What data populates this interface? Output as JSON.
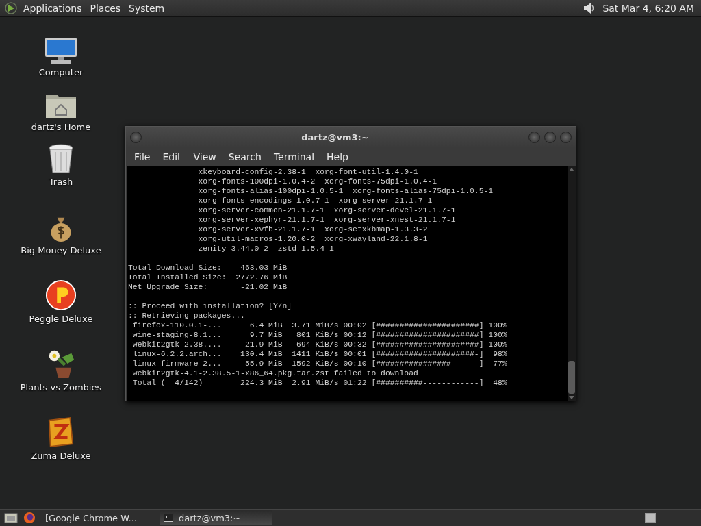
{
  "top_panel": {
    "menus": [
      "Applications",
      "Places",
      "System"
    ],
    "clock": "Sat Mar  4,  6:20 AM"
  },
  "desktop_icons": [
    {
      "kind": "computer",
      "label": "Computer"
    },
    {
      "kind": "home",
      "label": "dartz's Home"
    },
    {
      "kind": "trash",
      "label": "Trash"
    },
    {
      "kind": "money",
      "label": "Big Money Deluxe"
    },
    {
      "kind": "peggle",
      "label": "Peggle Deluxe"
    },
    {
      "kind": "plants",
      "label": "Plants vs Zombies"
    },
    {
      "kind": "zuma",
      "label": "Zuma Deluxe"
    }
  ],
  "window": {
    "title": "dartz@vm3:~",
    "menu": [
      "File",
      "Edit",
      "View",
      "Search",
      "Terminal",
      "Help"
    ],
    "output_blocks": [
      {
        "lines": [
          "               xkeyboard-config-2.38-1  xorg-font-util-1.4.0-1",
          "               xorg-fonts-100dpi-1.0.4-2  xorg-fonts-75dpi-1.0.4-1",
          "               xorg-fonts-alias-100dpi-1.0.5-1  xorg-fonts-alias-75dpi-1.0.5-1",
          "               xorg-fonts-encodings-1.0.7-1  xorg-server-21.1.7-1",
          "               xorg-server-common-21.1.7-1  xorg-server-devel-21.1.7-1",
          "               xorg-server-xephyr-21.1.7-1  xorg-server-xnest-21.1.7-1",
          "               xorg-server-xvfb-21.1.7-1  xorg-setxkbmap-1.3.3-2",
          "               xorg-util-macros-1.20.0-2  xorg-xwayland-22.1.8-1",
          "               zenity-3.44.0-2  zstd-1.5.4-1"
        ]
      },
      {
        "lines": [
          "Total Download Size:    463.03 MiB",
          "Total Installed Size:  2772.76 MiB",
          "Net Upgrade Size:       -21.02 MiB"
        ]
      },
      {
        "lines": [
          ":: Proceed with installation? [Y/n]",
          ":: Retrieving packages...",
          " firefox-110.0.1-...      6.4 MiB  3.71 MiB/s 00:02 [######################] 100%",
          " wine-staging-8.1...      9.7 MiB   801 KiB/s 00:12 [######################] 100%",
          " webkit2gtk-2.38....     21.9 MiB   694 KiB/s 00:32 [######################] 100%",
          " linux-6.2.2.arch...    130.4 MiB  1411 KiB/s 00:01 [#####################-]  98%",
          " linux-firmware-2...     55.9 MiB  1592 KiB/s 00:10 [################------]  77%",
          " webkit2gtk-4.1-2.38.5-1-x86_64.pkg.tar.zst failed to download",
          " Total (  4/142)        224.3 MiB  2.91 MiB/s 01:22 [##########------------]  48%"
        ]
      }
    ]
  },
  "taskbar": {
    "tasks": [
      {
        "label": "[Google Chrome W...",
        "selected": false
      },
      {
        "label": "dartz@vm3:~",
        "selected": true
      }
    ]
  }
}
